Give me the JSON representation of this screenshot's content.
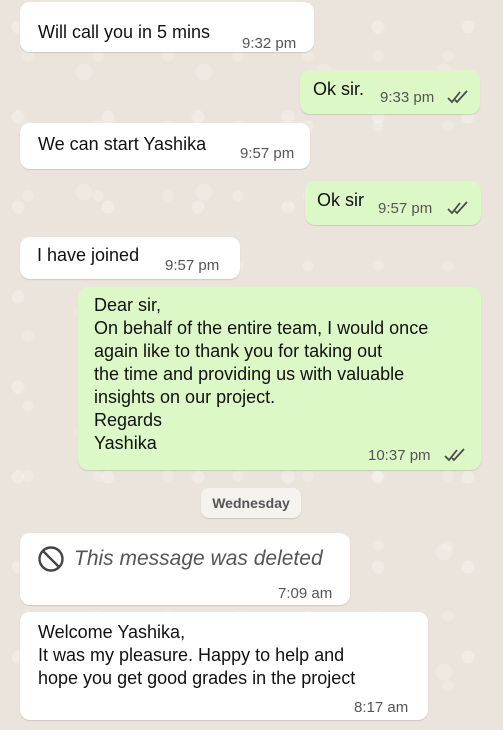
{
  "messages": [
    {
      "text": "Will call you in 5 mins",
      "time": "9:32 pm"
    },
    {
      "text": "Ok sir.",
      "time": "9:33 pm"
    },
    {
      "text": "We can start Yashika",
      "time": "9:57 pm"
    },
    {
      "text": "Ok sir",
      "time": "9:57 pm"
    },
    {
      "text": "I have joined",
      "time": "9:57 pm"
    },
    {
      "lines": [
        "Dear sir,",
        "On behalf of the entire team, I would once",
        "again like to thank you for taking out",
        "the time and providing us with valuable",
        "insights on our project.",
        "Regards",
        "Yashika"
      ],
      "time": "10:37 pm"
    },
    {
      "text": "This message was deleted",
      "time": "7:09 am"
    },
    {
      "lines": [
        "Welcome Yashika,",
        "It was my pleasure. Happy to help and",
        "hope you get good grades in the project"
      ],
      "time": "8:17 am"
    }
  ],
  "date_separator": "Wednesday",
  "colors": {
    "incoming": "#ffffff",
    "outgoing": "#dcf8c6",
    "read_ticks": "#4a4a4a"
  },
  "icons": {
    "read_receipt": "double-check-icon",
    "deleted": "blocked-icon"
  }
}
